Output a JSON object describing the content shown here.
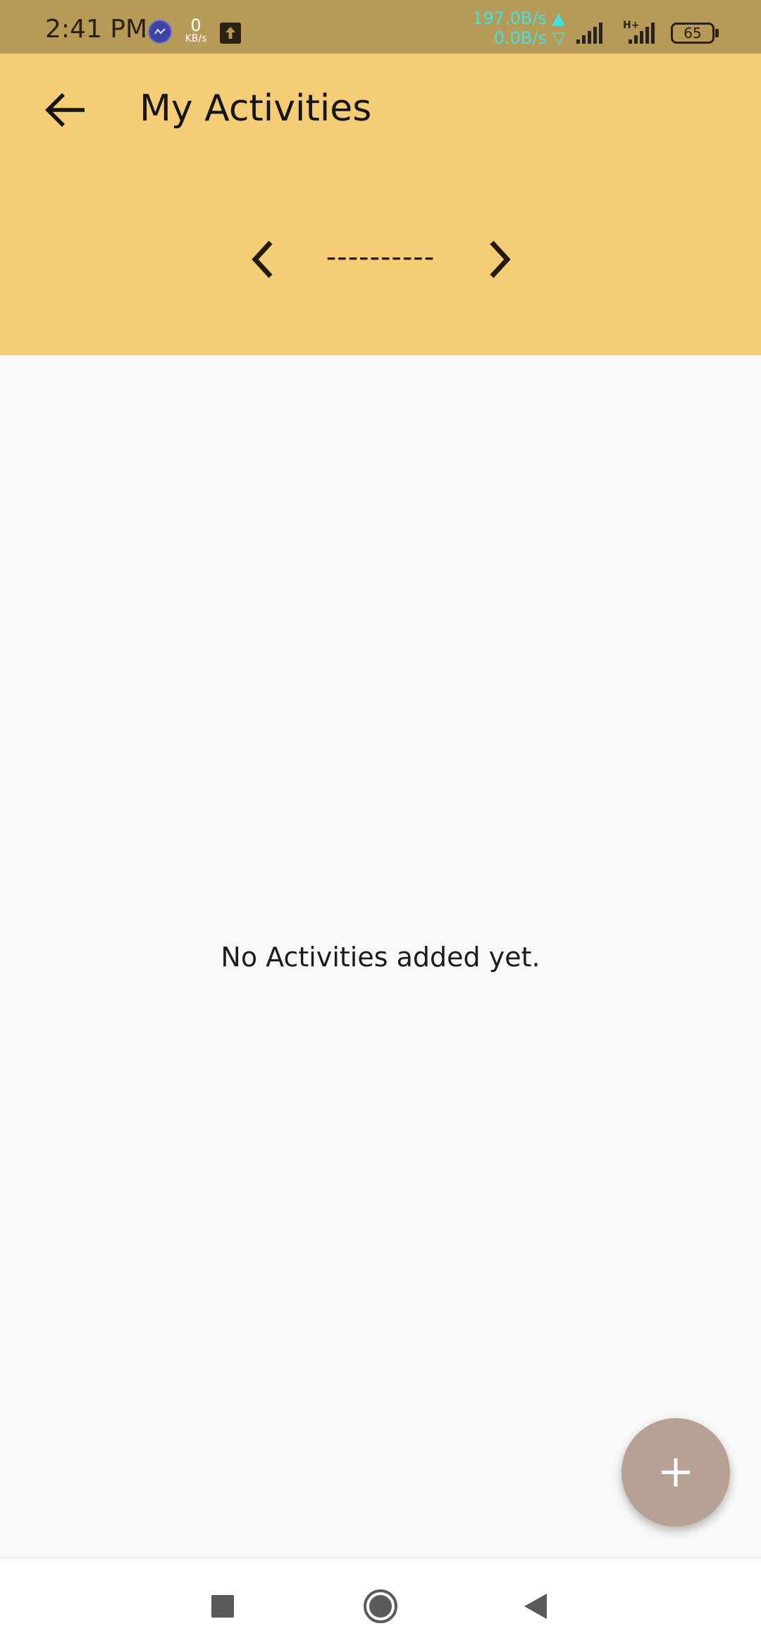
{
  "status_bar": {
    "time": "2:41 PM",
    "data_counter_value": "0",
    "data_counter_unit": "KB/s",
    "upload_speed": "197.0B/s ▲",
    "download_speed": "0.0B/s ▽",
    "network_type": "H+",
    "battery_level": "65",
    "icons": [
      "vpn-icon",
      "upload-notification-icon",
      "signal-icon",
      "signal-icon",
      "battery-icon"
    ]
  },
  "header": {
    "title": "My Activities",
    "back_icon": "arrow-left-icon",
    "period_label": "----------",
    "prev_icon": "chevron-left-icon",
    "next_icon": "chevron-right-icon"
  },
  "content": {
    "empty_message": "No Activities added yet."
  },
  "fab": {
    "icon": "plus-icon"
  },
  "nav_bar": {
    "icons": [
      "recents-square-icon",
      "home-circle-icon",
      "back-triangle-icon"
    ]
  },
  "colors": {
    "status_bar_bg": "#b89a58",
    "header_bg": "#f6cd77",
    "content_bg": "#f9f9f9",
    "fab_bg": "#b7a195",
    "speed_text": "#3fe3e0"
  }
}
